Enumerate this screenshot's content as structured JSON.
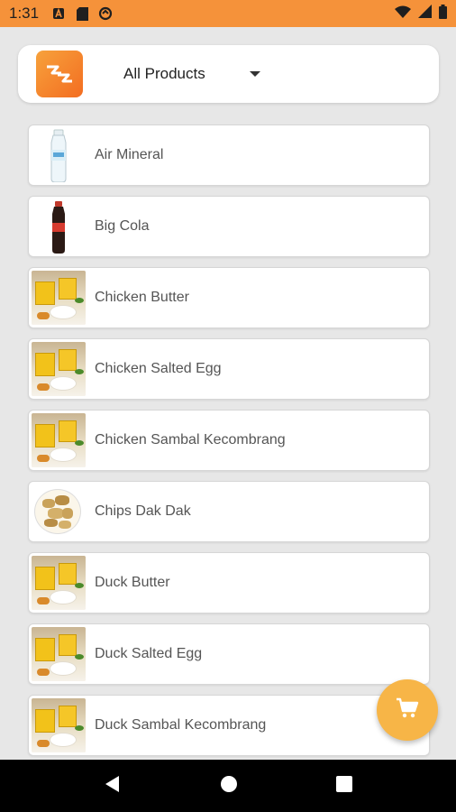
{
  "status": {
    "time": "1:31",
    "icons": [
      "a-icon",
      "sd-card-icon",
      "sync-icon"
    ],
    "right_icons": [
      "wifi-icon",
      "signal-icon",
      "battery-icon"
    ]
  },
  "header": {
    "logo": "app-logo",
    "category": "All Products"
  },
  "products": [
    {
      "name": "Air Mineral",
      "thumb": "bottle-water"
    },
    {
      "name": "Big Cola",
      "thumb": "bottle-cola"
    },
    {
      "name": "Chicken Butter",
      "thumb": "food-box"
    },
    {
      "name": "Chicken Salted Egg",
      "thumb": "food-box"
    },
    {
      "name": "Chicken Sambal Kecombrang",
      "thumb": "food-box"
    },
    {
      "name": "Chips Dak Dak",
      "thumb": "chips"
    },
    {
      "name": "Duck Butter",
      "thumb": "food-box"
    },
    {
      "name": "Duck Salted Egg",
      "thumb": "food-box"
    },
    {
      "name": "Duck Sambal Kecombrang",
      "thumb": "food-box"
    }
  ],
  "fab": {
    "icon": "cart-icon"
  },
  "nav": {
    "icons": [
      "back-icon",
      "home-icon",
      "recents-icon"
    ]
  },
  "colors": {
    "accent": "#f5923a",
    "fab": "#f7b547"
  }
}
